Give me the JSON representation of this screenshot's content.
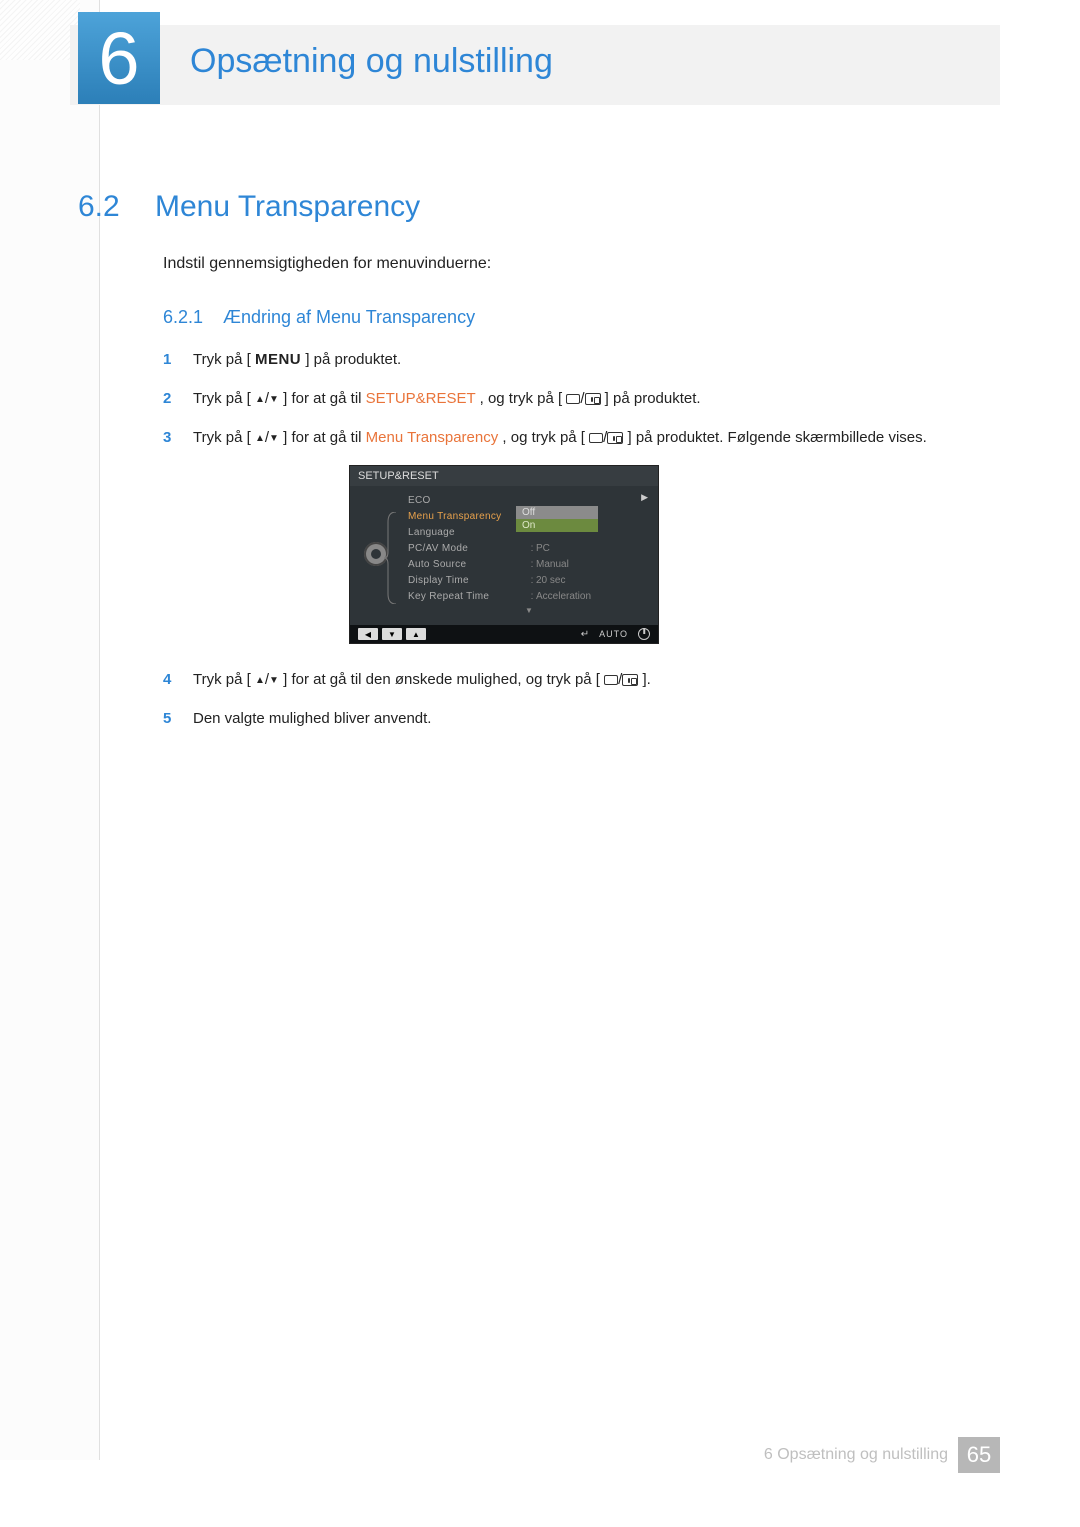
{
  "chapter": {
    "number": "6",
    "title": "Opsætning og nulstilling"
  },
  "section": {
    "number": "6.2",
    "title": "Menu Transparency"
  },
  "intro_text": "Indstil gennemsigtigheden for menuvinduerne:",
  "subsection": {
    "number": "6.2.1",
    "title": "Ændring af Menu Transparency"
  },
  "steps": [
    {
      "n": "1",
      "pre": "Tryk på [",
      "menu": "MENU",
      "post": "] på produktet."
    },
    {
      "n": "2",
      "pre": "Tryk på [",
      "updown": "▲/▼",
      "mid1": "] for at gå til ",
      "target": "SETUP&RESET",
      "mid2": ", og tryk på [",
      "enter": "icons",
      "post": "] på produktet."
    },
    {
      "n": "3",
      "pre": "Tryk på [",
      "updown": "▲/▼",
      "mid1": "] for at gå til ",
      "target": "Menu Transparency",
      "mid2": " , og tryk på [",
      "enter": "icons",
      "post": "] på produktet. Følgende skærmbillede vises."
    },
    {
      "n": "4",
      "pre": "Tryk på [",
      "updown": "▲/▼",
      "mid1": "] for at gå til den ønskede mulighed, og tryk på [",
      "enter": "icons",
      "post": "]."
    },
    {
      "n": "5",
      "plain": "Den valgte mulighed bliver anvendt."
    }
  ],
  "osd": {
    "title": "SETUP&RESET",
    "rows": [
      {
        "label": "ECO",
        "value": ""
      },
      {
        "label": "Menu Transparency",
        "value": "",
        "selected": true
      },
      {
        "label": "Language",
        "value": ""
      },
      {
        "label": "PC/AV Mode",
        "value": "PC"
      },
      {
        "label": "Auto Source",
        "value": "Manual"
      },
      {
        "label": "Display Time",
        "value": "20 sec"
      },
      {
        "label": "Key Repeat Time",
        "value": "Acceleration"
      }
    ],
    "options": [
      {
        "label": "Off",
        "cls": "off"
      },
      {
        "label": "On",
        "cls": "on"
      }
    ],
    "footer_auto": "AUTO"
  },
  "footer": {
    "label": "6 Opsætning og nulstilling",
    "page": "65"
  }
}
